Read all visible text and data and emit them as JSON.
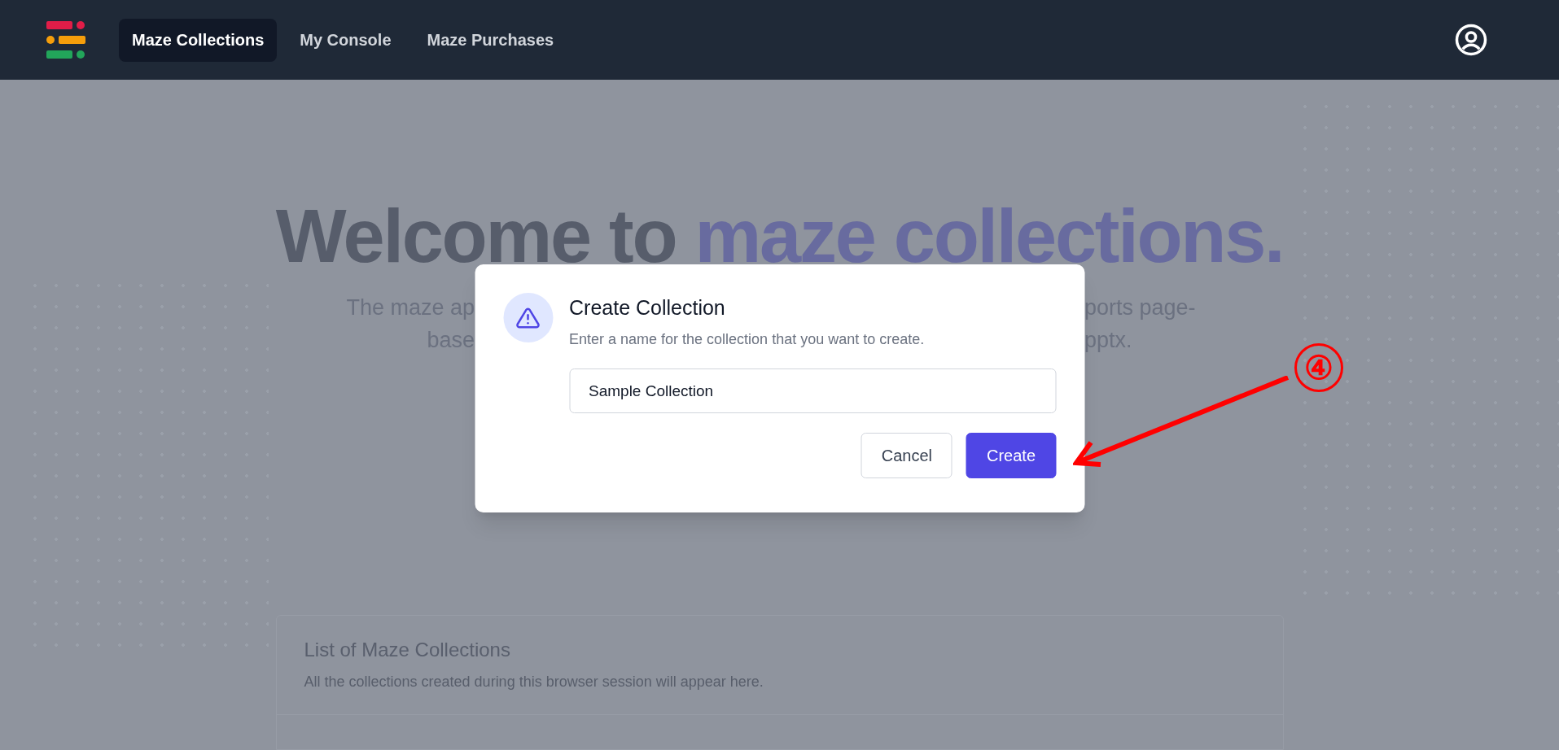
{
  "nav": {
    "items": [
      {
        "label": "Maze Collections",
        "selected": true
      },
      {
        "label": "My Console",
        "selected": false
      },
      {
        "label": "Maze Purchases",
        "selected": false
      }
    ]
  },
  "hero": {
    "title": "Welcome to",
    "title_highlight": "maze collections.",
    "lines": [
      {
        "left": "The maze ap",
        "right": "ports page-"
      },
      {
        "left": "base",
        "right": "pptx."
      }
    ]
  },
  "dialog": {
    "title": "Create Collection",
    "message": "Enter a name for the collection that you want to create.",
    "input": {
      "value": "Sample Collection"
    },
    "buttons": [
      {
        "label": "Cancel",
        "kind": "secondary"
      },
      {
        "label": "Create",
        "kind": "primary"
      }
    ]
  },
  "collections_card": {
    "title": "List of Maze Collections",
    "subtitle": "All the collections created during this browser session will appear here."
  },
  "annotation": {
    "label": "④"
  }
}
